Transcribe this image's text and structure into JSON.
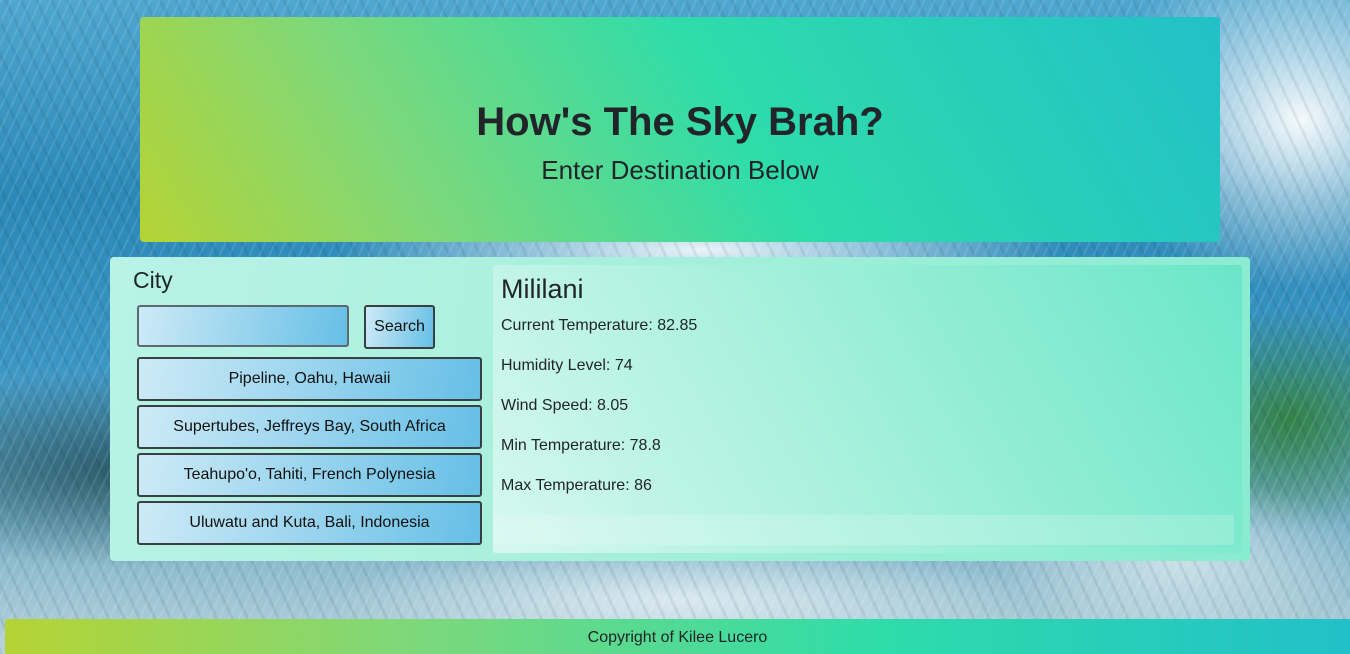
{
  "hero": {
    "title": "How's The Sky Brah?",
    "subtitle": "Enter Destination Below"
  },
  "search": {
    "label": "City",
    "input_value": "",
    "button_label": "Search"
  },
  "cities": [
    {
      "label": "Pipeline, Oahu, Hawaii"
    },
    {
      "label": "Supertubes, Jeffreys Bay, South Africa"
    },
    {
      "label": "Teahupo'o, Tahiti, French Polynesia"
    },
    {
      "label": "Uluwatu and Kuta, Bali, Indonesia"
    }
  ],
  "weather": {
    "city": "Mililani",
    "current_temperature": "Current Temperature: 82.85",
    "humidity": "Humidity Level: 74",
    "wind_speed": "Wind Speed: 8.05",
    "min_temperature": "Min Temperature: 78.8",
    "max_temperature": "Max Temperature: 86"
  },
  "footer": {
    "text": "Copyright of Kilee Lucero"
  },
  "colors": {
    "gradient_start": "#b5d334",
    "gradient_mid": "#2edcaa",
    "gradient_end": "#22c0c8",
    "panel": "#a9f0dc",
    "button_light": "#cdeaf6",
    "button_dark": "#66bfe6"
  }
}
